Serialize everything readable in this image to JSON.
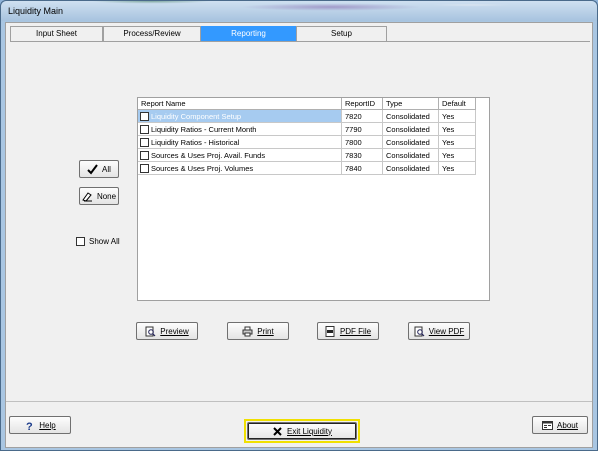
{
  "window": {
    "title": "Liquidity Main"
  },
  "tabs": [
    {
      "label": "Input Sheet",
      "active": false
    },
    {
      "label": "Process/Review",
      "active": false
    },
    {
      "label": "Reporting",
      "active": true
    },
    {
      "label": "Setup",
      "active": false
    }
  ],
  "select_buttons": {
    "all": "All",
    "none": "None"
  },
  "show_all": {
    "label": "Show All",
    "checked": false
  },
  "report_table": {
    "columns": [
      "Report Name",
      "ReportID",
      "Type",
      "Default"
    ],
    "rows": [
      {
        "name": "Liquidity Component Setup",
        "id": "7820",
        "type": "Consolidated",
        "default": "Yes",
        "selected": true
      },
      {
        "name": "Liquidity Ratios - Current Month",
        "id": "7790",
        "type": "Consolidated",
        "default": "Yes",
        "selected": false
      },
      {
        "name": "Liquidity Ratios - Historical",
        "id": "7800",
        "type": "Consolidated",
        "default": "Yes",
        "selected": false
      },
      {
        "name": "Sources & Uses Proj. Avail. Funds",
        "id": "7830",
        "type": "Consolidated",
        "default": "Yes",
        "selected": false
      },
      {
        "name": "Sources & Uses Proj. Volumes",
        "id": "7840",
        "type": "Consolidated",
        "default": "Yes",
        "selected": false
      }
    ]
  },
  "actions": {
    "preview": "Preview",
    "print": "Print",
    "pdf_file": "PDF File",
    "view_pdf": "View PDF"
  },
  "footer": {
    "help": "Help",
    "exit": "Exit Liquidity",
    "about": "About"
  },
  "colors": {
    "accent": "#3399ff",
    "selection": "#a6cbf0",
    "focus_frame": "#f0e000"
  }
}
